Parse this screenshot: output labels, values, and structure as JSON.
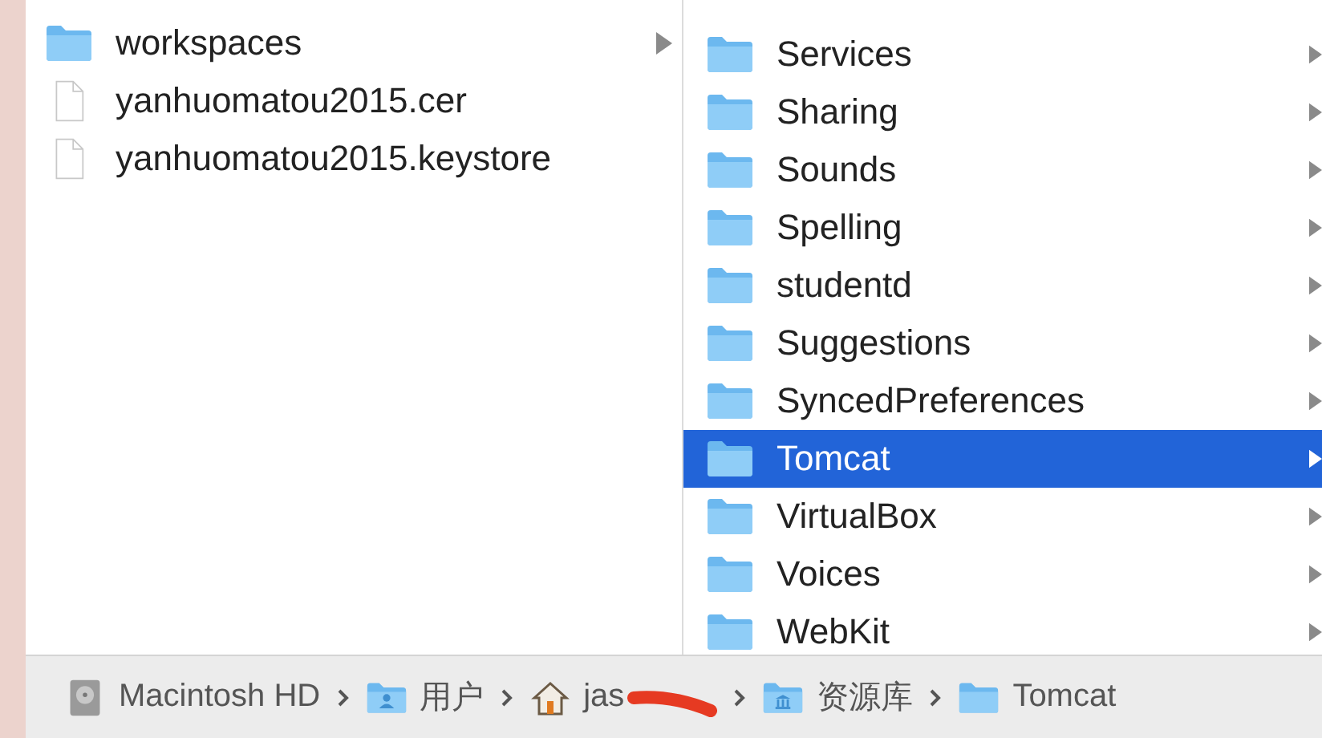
{
  "columns": [
    {
      "items": [
        {
          "name": "workspaces",
          "kind": "folder",
          "has_children": true,
          "selected": false
        },
        {
          "name": "yanhuomatou2015.cer",
          "kind": "file",
          "has_children": false,
          "selected": false
        },
        {
          "name": "yanhuomatou2015.keystore",
          "kind": "file",
          "has_children": false,
          "selected": false
        }
      ]
    },
    {
      "items": [
        {
          "name": "Services",
          "kind": "folder",
          "has_children": true,
          "selected": false
        },
        {
          "name": "Sharing",
          "kind": "folder",
          "has_children": true,
          "selected": false
        },
        {
          "name": "Sounds",
          "kind": "folder",
          "has_children": true,
          "selected": false
        },
        {
          "name": "Spelling",
          "kind": "folder",
          "has_children": true,
          "selected": false
        },
        {
          "name": "studentd",
          "kind": "folder",
          "has_children": true,
          "selected": false
        },
        {
          "name": "Suggestions",
          "kind": "folder",
          "has_children": true,
          "selected": false
        },
        {
          "name": "SyncedPreferences",
          "kind": "folder",
          "has_children": true,
          "selected": false
        },
        {
          "name": "Tomcat",
          "kind": "folder",
          "has_children": true,
          "selected": true
        },
        {
          "name": "VirtualBox",
          "kind": "folder",
          "has_children": true,
          "selected": false
        },
        {
          "name": "Voices",
          "kind": "folder",
          "has_children": true,
          "selected": false
        },
        {
          "name": "WebKit",
          "kind": "folder",
          "has_children": true,
          "selected": false
        }
      ]
    }
  ],
  "path_bar": [
    {
      "name": "Macintosh HD",
      "kind": "disk"
    },
    {
      "name": "用户",
      "kind": "users"
    },
    {
      "name": "jas",
      "kind": "home",
      "redacted": true
    },
    {
      "name": "资源库",
      "kind": "library"
    },
    {
      "name": "Tomcat",
      "kind": "folder"
    }
  ]
}
